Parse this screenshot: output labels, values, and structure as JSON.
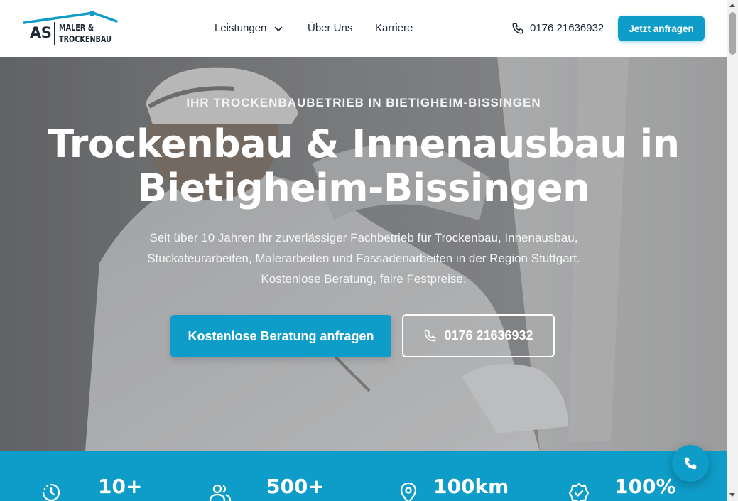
{
  "brand": {
    "logo_mark": "AS",
    "logo_line1": "MALER &",
    "logo_line2": "TROCKENBAU",
    "accent_color": "#0e9cc8",
    "dark_color": "#1f2a37"
  },
  "nav": {
    "items": [
      {
        "label": "Leistungen",
        "has_dropdown": true
      },
      {
        "label": "Über Uns"
      },
      {
        "label": "Karriere"
      }
    ],
    "phone": "0176 21636932",
    "cta": "Jetzt anfragen"
  },
  "hero": {
    "eyebrow": "IHR TROCKENBAUBETRIEB IN BIETIGHEIM-BISSINGEN",
    "title_line1": "Trockenbau & Innenausbau in",
    "title_line2": "Bietigheim-Bissingen",
    "subtitle_line1": "Seit über 10 Jahren Ihr zuverlässiger Fachbetrieb für Trockenbau, Innenausbau,",
    "subtitle_line2": "Stuckateurarbeiten, Malerarbeiten und Fassadenarbeiten in der Region Stuttgart.",
    "subtitle_line3": "Kostenlose Beratung, faire Festpreise.",
    "primary_button": "Kostenlose Beratung anfragen",
    "secondary_button": "0176 21636932"
  },
  "stats": [
    {
      "icon": "clock-icon",
      "value": "10+"
    },
    {
      "icon": "users-icon",
      "value": "500+"
    },
    {
      "icon": "map-pin-icon",
      "value": "100km"
    },
    {
      "icon": "badge-check-icon",
      "value": "100%"
    }
  ],
  "icons": {
    "chevron": "chevron-down-icon",
    "phone": "phone-icon",
    "fab": "phone-icon"
  }
}
